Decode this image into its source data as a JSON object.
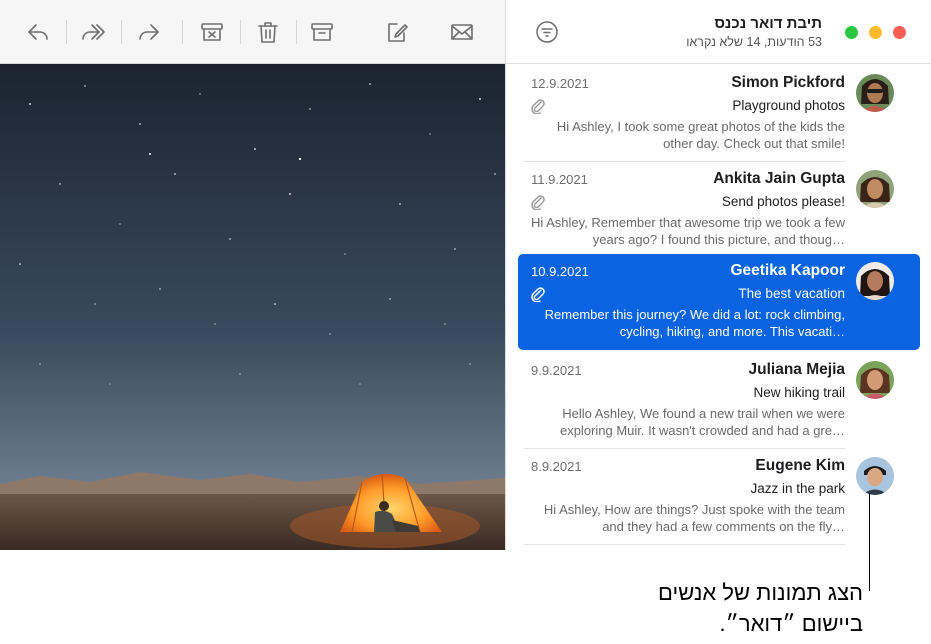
{
  "toolbar": {
    "buttons": [
      {
        "name": "reply-icon"
      },
      {
        "name": "reply-all-icon"
      },
      {
        "name": "forward-icon"
      },
      {
        "name": "archive-junk-icon"
      },
      {
        "name": "trash-icon"
      },
      {
        "name": "archive-icon"
      },
      {
        "name": "compose-icon"
      },
      {
        "name": "get-mail-icon"
      }
    ]
  },
  "mailbox": {
    "title": "תיבת דואר נכנס",
    "subtitle": "53 הודעות, 14 שלא נקראו",
    "filter_icon": "filter-icon",
    "window_controls": [
      "close",
      "minimize",
      "zoom"
    ]
  },
  "messages": [
    {
      "sender": "Simon Pickford",
      "date": "12.9.2021",
      "subject": "Playground photos",
      "preview": "Hi Ashley, I took some great photos of the kids the other day. Check out that smile!",
      "has_attachment": true,
      "selected": false
    },
    {
      "sender": "Ankita Jain Gupta",
      "date": "11.9.2021",
      "subject": "Send photos please!",
      "preview": "Hi Ashley, Remember that awesome trip we took a few years ago? I found this picture, and thoug…",
      "has_attachment": true,
      "selected": false
    },
    {
      "sender": "Geetika Kapoor",
      "date": "10.9.2021",
      "subject": "The best vacation",
      "preview": "Remember this journey? We did a lot: rock climbing, cycling, hiking, and more. This vacati…",
      "has_attachment": true,
      "selected": true
    },
    {
      "sender": "Juliana Mejia",
      "date": "9.9.2021",
      "subject": "New hiking trail",
      "preview": "Hello Ashley, We found a new trail when we were exploring Muir. It wasn't crowded and had a gre…",
      "has_attachment": false,
      "selected": false
    },
    {
      "sender": "Eugene Kim",
      "date": "8.9.2021",
      "subject": "Jazz in the park",
      "preview": "Hi Ashley, How are things? Just spoke with the team and they had a few comments on the fly…",
      "has_attachment": false,
      "selected": false
    }
  ],
  "callout": {
    "line1": "הצג תמונות של אנשים",
    "line2": "ביישום ״דואר״."
  },
  "colors": {
    "selection": "#0a63e0",
    "traffic_red": "#ff5f57",
    "traffic_yellow": "#febc2e",
    "traffic_green": "#2ac840"
  }
}
